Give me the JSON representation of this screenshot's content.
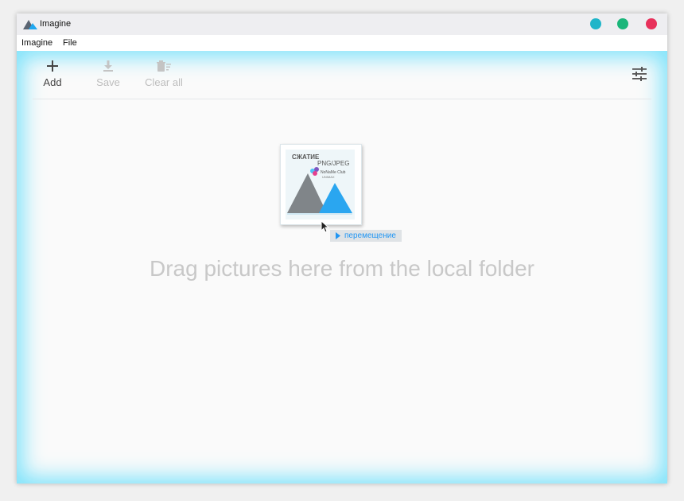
{
  "window": {
    "title": "Imagine",
    "logo_icon": "mountain-logo-icon",
    "buttons": [
      {
        "name": "minimize",
        "color": "#1fb5c9"
      },
      {
        "name": "maximize",
        "color": "#1ab67a"
      },
      {
        "name": "close",
        "color": "#e8315b"
      }
    ]
  },
  "menu": {
    "items": [
      "Imagine",
      "File"
    ]
  },
  "toolbar": {
    "add_label": "Add",
    "save_label": "Save",
    "clear_label": "Clear all",
    "add_icon": "plus-icon",
    "save_icon": "download-icon",
    "clear_icon": "clear-all-icon",
    "settings_icon": "sliders-icon",
    "enabled_color": "#444444",
    "disabled_color": "#bdbdbd"
  },
  "drag": {
    "thumbnail_lines": [
      "СЖАТИЕ",
      "PNG/JPEG",
      "NoNaMe Club",
      "UNIMAX"
    ],
    "badge_label": "перемещение",
    "accent": "#2196f3"
  },
  "drop_hint": "Drag pictures here from the local folder"
}
